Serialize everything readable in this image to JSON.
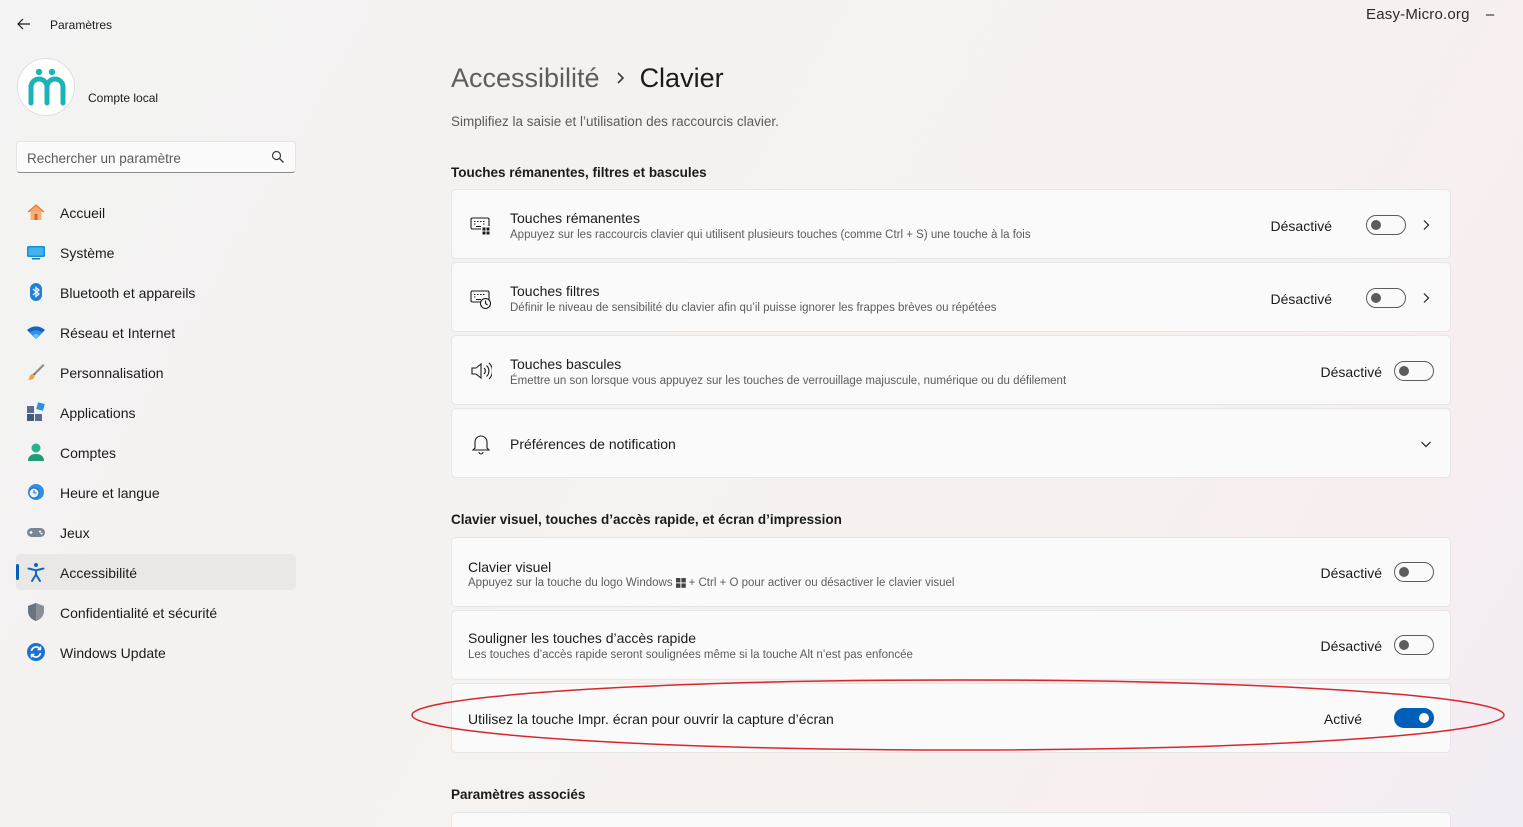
{
  "titlebar": {
    "title": "Paramètres",
    "watermark": "Easy-Micro.org",
    "minimize": "–"
  },
  "account": {
    "name": "Compte local"
  },
  "search": {
    "placeholder": "Rechercher un paramètre"
  },
  "sidebar": {
    "items": [
      {
        "label": "Accueil",
        "icon": "home-icon"
      },
      {
        "label": "Système",
        "icon": "system-icon"
      },
      {
        "label": "Bluetooth et appareils",
        "icon": "bluetooth-icon"
      },
      {
        "label": "Réseau et Internet",
        "icon": "wifi-icon"
      },
      {
        "label": "Personnalisation",
        "icon": "brush-icon"
      },
      {
        "label": "Applications",
        "icon": "apps-icon"
      },
      {
        "label": "Comptes",
        "icon": "person-icon"
      },
      {
        "label": "Heure et langue",
        "icon": "clock-globe-icon"
      },
      {
        "label": "Jeux",
        "icon": "gamepad-icon"
      },
      {
        "label": "Accessibilité",
        "icon": "accessibility-icon",
        "selected": true
      },
      {
        "label": "Confidentialité et sécurité",
        "icon": "shield-icon"
      },
      {
        "label": "Windows Update",
        "icon": "update-icon"
      }
    ]
  },
  "breadcrumb": {
    "parent": "Accessibilité",
    "current": "Clavier"
  },
  "page": {
    "description": "Simplifiez la saisie et l’utilisation des raccourcis clavier."
  },
  "sections": {
    "sticky": {
      "title": "Touches rémanentes, filtres et bascules",
      "cards": [
        {
          "title": "Touches rémanentes",
          "subtitle": "Appuyez sur les raccourcis clavier qui utilisent plusieurs touches (comme Ctrl + S) une touche à la fois",
          "state": "Désactivé",
          "on": false,
          "icon": "sticky-keys-icon"
        },
        {
          "title": "Touches filtres",
          "subtitle": "Définir le niveau de sensibilité du clavier afin qu’il puisse ignorer les frappes brèves ou répétées",
          "state": "Désactivé",
          "on": false,
          "icon": "filter-keys-icon"
        },
        {
          "title": "Touches bascules",
          "subtitle": "Émettre un son lorsque vous appuyez sur les touches de verrouillage majuscule, numérique ou du défilement",
          "state": "Désactivé",
          "on": false,
          "icon": "speaker-icon"
        },
        {
          "title": "Préférences de notification",
          "icon": "bell-icon"
        }
      ]
    },
    "visual": {
      "title": "Clavier visuel, touches d’accès rapide, et écran d’impression",
      "cards": [
        {
          "title": "Clavier visuel",
          "subtitle_before": "Appuyez sur la touche du logo Windows",
          "subtitle_after": "+ Ctrl + O pour activer ou désactiver le clavier visuel",
          "state": "Désactivé",
          "on": false
        },
        {
          "title": "Souligner les touches d’accès rapide",
          "subtitle": "Les touches d’accès rapide seront soulignées même si la touche Alt n’est pas enfoncée",
          "state": "Désactivé",
          "on": false
        },
        {
          "title": "Utilisez la touche Impr. écran pour ouvrir la capture d’écran",
          "state": "Activé",
          "on": true
        }
      ]
    },
    "related": {
      "title": "Paramètres associés"
    }
  },
  "colors": {
    "accent": "#005fb8",
    "annotation": "#d9262e",
    "avatar_logo": "#19b3b8"
  }
}
